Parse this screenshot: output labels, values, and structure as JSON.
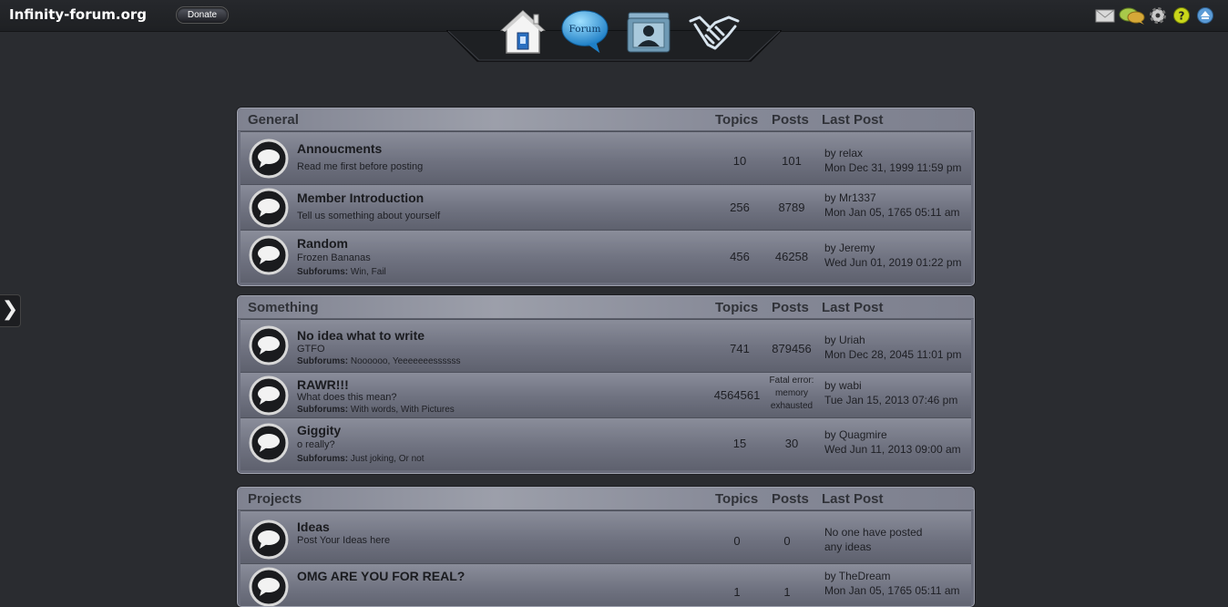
{
  "header": {
    "site_title": "Infinity-forum.org",
    "donate_label": "Donate",
    "nav": [
      {
        "name": "home-icon"
      },
      {
        "name": "forum-icon",
        "label": "Forum"
      },
      {
        "name": "members-icon"
      },
      {
        "name": "partners-icon"
      }
    ],
    "right_icons": [
      "mail-icon",
      "chat-icon",
      "gear-icon",
      "help-icon",
      "scroll-top-icon"
    ]
  },
  "sidebar_toggle": "❯",
  "columns": {
    "topics": "Topics",
    "posts": "Posts",
    "last_post": "Last Post"
  },
  "categories": [
    {
      "title": "General",
      "forums": [
        {
          "title": "Annoucments",
          "desc": "Read me first before posting",
          "subforums": "",
          "topics": "10",
          "posts": "101",
          "last_by": "by relax",
          "last_date": "Mon Dec 31, 1999 11:59 pm"
        },
        {
          "title": "Member Introduction",
          "desc": "Tell us something about yourself",
          "subforums": "",
          "topics": "256",
          "posts": "8789",
          "last_by": "by Mr1337",
          "last_date": "Mon Jan 05, 1765 05:11 am"
        },
        {
          "title": "Random",
          "desc": "Frozen Bananas",
          "subforums_label": "Subforums:",
          "subforums": "Win, Fail",
          "topics": "456",
          "posts": "46258",
          "last_by": "by Jeremy",
          "last_date": "Wed Jun 01, 2019 01:22 pm"
        }
      ]
    },
    {
      "title": "Something",
      "forums": [
        {
          "title": "No idea what to write",
          "desc": "GTFO",
          "subforums_label": "Subforums:",
          "subforums": "Noooooo, Yeeeeeeessssss",
          "topics": "741",
          "posts": "879456",
          "last_by": "by Uriah",
          "last_date": "Mon Dec 28, 2045 11:01 pm"
        },
        {
          "title": "RAWR!!!",
          "desc": "What does this mean?",
          "subforums_label": "Subforums:",
          "subforums": "With words, With Pictures",
          "topics": "4564561",
          "posts_error": [
            "Fatal error:",
            "memory",
            "exhausted"
          ],
          "last_by": "by wabi",
          "last_date": "Tue Jan 15, 2013 07:46 pm"
        },
        {
          "title": "Giggity",
          "desc": "o really?",
          "subforums_label": "Subforums:",
          "subforums": "Just joking, Or not",
          "topics": "15",
          "posts": "30",
          "last_by": "by Quagmire",
          "last_date": "Wed Jun 11, 2013 09:00 am"
        }
      ]
    },
    {
      "title": "Projects",
      "forums": [
        {
          "title": "Ideas",
          "desc": "Post Your Ideas here",
          "topics": "0",
          "posts": "0",
          "last_by": "No one have posted",
          "last_date": "any ideas"
        },
        {
          "title": "OMG ARE YOU FOR REAL?",
          "desc": "",
          "topics": "1",
          "posts": "1",
          "last_by": "by TheDream",
          "last_date": "Mon Jan 05, 1765 05:11 am"
        }
      ]
    }
  ]
}
